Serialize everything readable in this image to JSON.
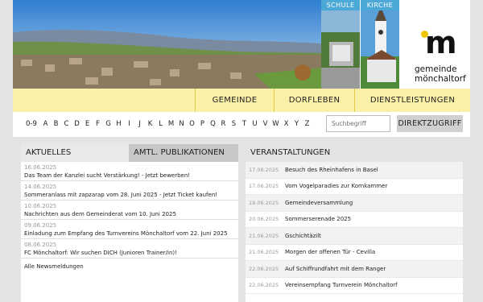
{
  "header": {
    "tiles": [
      {
        "label": "SCHULE"
      },
      {
        "label": "KIRCHE"
      }
    ],
    "logo": {
      "mark": "m",
      "line1": "gemeinde",
      "line2": "mönchaltorf"
    }
  },
  "nav": {
    "items": [
      {
        "label": "GEMEINDE"
      },
      {
        "label": "DORFLEBEN"
      },
      {
        "label": "DIENSTLEISTUNGEN"
      }
    ]
  },
  "az": {
    "letters": [
      "0-9",
      "A",
      "B",
      "C",
      "D",
      "E",
      "F",
      "G",
      "H",
      "I",
      "J",
      "K",
      "L",
      "M",
      "N",
      "O",
      "P",
      "Q",
      "R",
      "S",
      "T",
      "U",
      "V",
      "W",
      "X",
      "Y",
      "Z"
    ],
    "search_placeholder": "Suchbegriff",
    "direct_label": "DIREKTZUGRIFF"
  },
  "news": {
    "tab_active": "AKTUELLES",
    "tab_other": "AMTL. PUBLIKATIONEN",
    "items": [
      {
        "date": "16.06.2025",
        "title": "Das Team der Kanzlei sucht Verstärkung! - Jetzt bewerben!"
      },
      {
        "date": "14.06.2025",
        "title": "Sommeranlass mit zapzarap vom 28. Juni 2025 - Jetzt Ticket kaufen!"
      },
      {
        "date": "10.06.2025",
        "title": "Nachrichten aus dem Gemeinderat vom 10. Juni 2025"
      },
      {
        "date": "09.06.2025",
        "title": "Einladung zum Empfang des Turnvereins Mönchaltorf vom 22. Juni 2025"
      },
      {
        "date": "08.06.2025",
        "title": "FC Mönchaltorf: Wir suchen DICH (Junioren Trainer/in)!"
      }
    ],
    "all_label": "Alle Newsmeldungen"
  },
  "events": {
    "title": "VERANSTALTUNGEN",
    "items": [
      {
        "date": "17.06.2025",
        "title": "Besuch des Rheinhafens in Basel"
      },
      {
        "date": "17.06.2025",
        "title": "Vom Vogelparadies zur Kornkammer"
      },
      {
        "date": "19.06.2025",
        "title": "Gemeindeversammlung"
      },
      {
        "date": "20.06.2025",
        "title": "Sommerserenade 2025"
      },
      {
        "date": "21.06.2025",
        "title": "Gschichtäzilt"
      },
      {
        "date": "21.06.2025",
        "title": "Morgen der offenen Tür - Cevilla"
      },
      {
        "date": "22.06.2025",
        "title": "Auf Schiffrundfahrt mit dem Ranger"
      },
      {
        "date": "22.06.2025",
        "title": "Vereinsempfang Turnverein Mönchaltorf"
      }
    ]
  },
  "colors": {
    "nav_bg": "#fbf0a8",
    "tile_label": "#4ca8d6",
    "logo_dot": "#f0c400"
  }
}
